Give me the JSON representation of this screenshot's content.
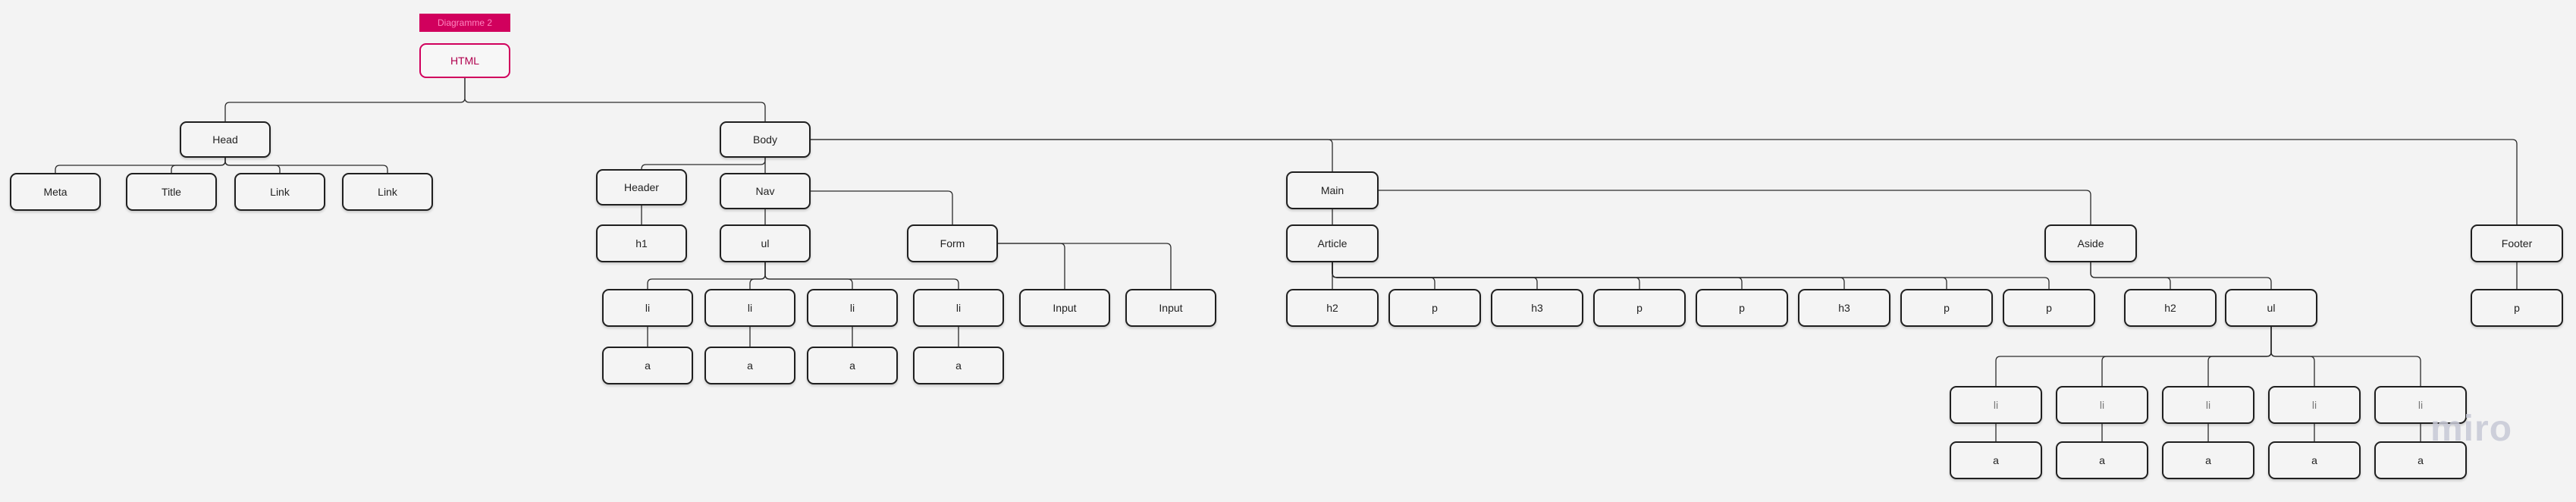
{
  "tag_label": "Diagramme 2",
  "watermark": "miro",
  "nodes": {
    "html": "HTML",
    "head": "Head",
    "meta": "Meta",
    "title": "Title",
    "link1": "Link",
    "link2": "Link",
    "body": "Body",
    "header": "Header",
    "h1": "h1",
    "nav": "Nav",
    "ul1": "ul",
    "li1": "li",
    "li2": "li",
    "li3": "li",
    "li4": "li",
    "a1": "a",
    "a2": "a",
    "a3": "a",
    "a4": "a",
    "form": "Form",
    "input1": "Input",
    "input2": "Input",
    "main": "Main",
    "article": "Article",
    "ah2": "h2",
    "ap1": "p",
    "ah3a": "h3",
    "ap2": "p",
    "ap3": "p",
    "ah3b": "h3",
    "ap4": "p",
    "ap5": "p",
    "aside": "Aside",
    "sh2": "h2",
    "ul2": "ul",
    "li5": "li",
    "li6": "li",
    "li7": "li",
    "li8": "li",
    "li9": "li",
    "a5": "a",
    "a6": "a",
    "a7": "a",
    "a8": "a",
    "a9": "a",
    "footer": "Footer",
    "fp": "p"
  }
}
